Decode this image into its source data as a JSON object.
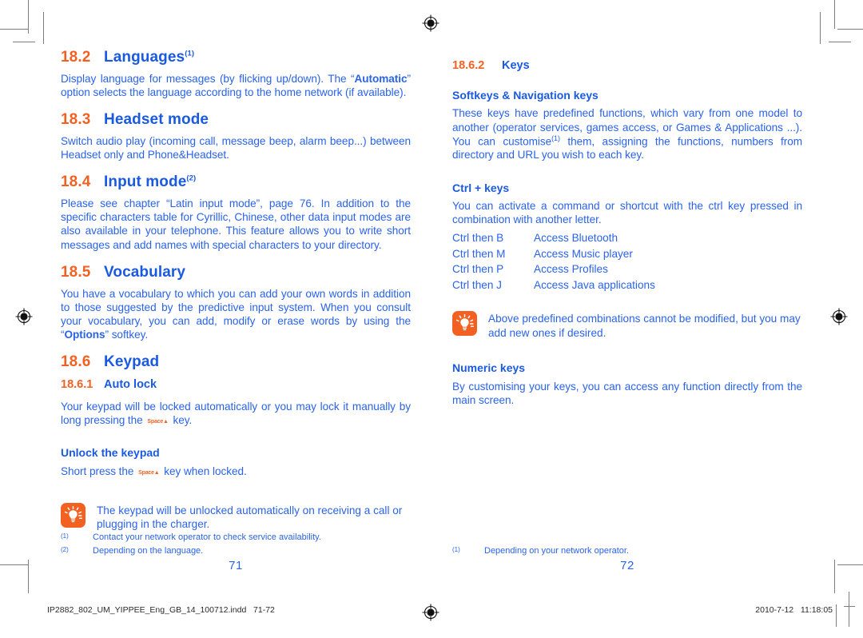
{
  "document": {
    "left_page": {
      "sections": [
        {
          "number": "18.2",
          "title": "Languages",
          "footnote_mark": "(1)",
          "body": "Display language for messages (by flicking up/down). The “Automatic” option selects the language according to the home network (if available)."
        },
        {
          "number": "18.3",
          "title": "Headset mode",
          "footnote_mark": "",
          "body": "Switch audio play (incoming call, message beep, alarm beep...) between Headset only and Phone&Headset."
        },
        {
          "number": "18.4",
          "title": "Input mode",
          "footnote_mark": "(2)",
          "body": "Please see chapter “Latin input mode”, page 76. In addition to the specific characters table for Cyrillic, Chinese, other data input modes are also available in your telephone. This feature allows you to write short messages and add names with special characters to your directory."
        },
        {
          "number": "18.5",
          "title": "Vocabulary",
          "footnote_mark": "",
          "body": "You have a vocabulary to which you can add your own words in addition to those suggested by the predictive input system. When you consult your vocabulary, you can add, modify or erase words by using the “Options” softkey."
        },
        {
          "number": "18.6",
          "title": "Keypad",
          "footnote_mark": "",
          "body": ""
        }
      ],
      "subsection": {
        "number": "18.6.1",
        "title": "Auto lock",
        "body_part1": "Your keypad will be locked automatically or you may lock it manually by long pressing the",
        "key_label": "Space",
        "body_part2": "key."
      },
      "unlock": {
        "heading": "Unlock the keypad",
        "body_part1": "Short press the",
        "key_label": "Space",
        "body_part2": "key when locked."
      },
      "note": {
        "icon": "lightbulb-icon",
        "text": "The keypad will be unlocked automatically on receiving a call or plugging in the charger."
      },
      "footnotes": [
        {
          "mark": "(1)",
          "text": "Contact your network operator to check service availability."
        },
        {
          "mark": "(2)",
          "text": "Depending on the language."
        }
      ],
      "folio": "71"
    },
    "right_page": {
      "subsection": {
        "number": "18.6.2",
        "title": "Keys"
      },
      "softkeys": {
        "heading": "Softkeys & Navigation keys",
        "body_part1": "These keys have predefined functions, which vary from one model to another (operator services, games access, or Games & Applications ...). You can customise",
        "footnote_mark": "(1)",
        "body_part2": "them, assigning the functions, numbers from directory and URL you wish to each key."
      },
      "ctrl_keys": {
        "heading": "Ctrl + keys",
        "body": "You can activate a command or shortcut with the ctrl key pressed in combination with another letter.",
        "shortcuts": [
          {
            "combo": "Ctrl then B",
            "action": "Access Bluetooth"
          },
          {
            "combo": "Ctrl then M",
            "action": "Access Music player"
          },
          {
            "combo": "Ctrl then P",
            "action": "Access Profiles"
          },
          {
            "combo": "Ctrl then J",
            "action": "Access Java applications"
          }
        ]
      },
      "note": {
        "icon": "lightbulb-icon",
        "text": "Above predefined combinations cannot be modified, but you may add new ones if desired."
      },
      "numeric_keys": {
        "heading": "Numeric keys",
        "body": "By customising your keys, you can access any function directly from the main screen."
      },
      "footnotes": [
        {
          "mark": "(1)",
          "text": "Depending on your network operator."
        }
      ],
      "folio": "72"
    }
  },
  "print_slug": {
    "filename": "IP2882_802_UM_YIPPEE_Eng_GB_14_100712.indd   71-72",
    "timestamp": "2010-7-12   11:18:05"
  },
  "colors": {
    "heading_blue": "#1a5ae0",
    "body_blue": "#2a63e8",
    "accent_orange": "#f26122"
  }
}
